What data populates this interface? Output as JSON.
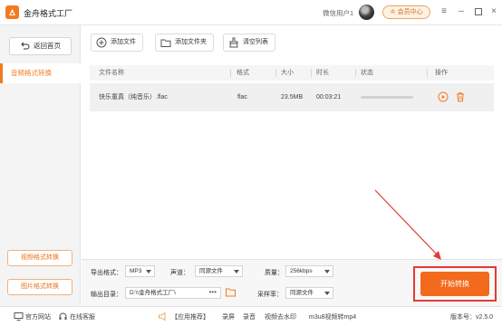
{
  "app": {
    "title": "金舟格式工厂"
  },
  "header": {
    "username": "微信用户1",
    "vip_label": "会员中心"
  },
  "sidebar": {
    "back_label": "返回首页",
    "active_item": "音频格式转换",
    "bottom_buttons": [
      "视频格式转换",
      "图片格式转换"
    ]
  },
  "toolbar": {
    "add_file": "添加文件",
    "add_folder": "添加文件夹",
    "clear_list": "清空列表"
  },
  "table": {
    "headers": [
      "文件名称",
      "格式",
      "大小",
      "时长",
      "状态",
      "操作"
    ],
    "rows": [
      {
        "name": "快乐童真（纯音乐）.flac",
        "format": "flac",
        "size": "23.5MB",
        "duration": "00:03:21",
        "progress": 0
      }
    ]
  },
  "settings": {
    "export_format_label": "导出格式：",
    "export_format_value": "MP3",
    "channel_label": "声道：",
    "channel_value": "同源文件",
    "quality_label": "质量：",
    "quality_value": "256kbps",
    "output_dir_label": "输出目录：",
    "output_dir_value": "D:\\\\金舟格式工厂\\",
    "output_dir_more": "•••",
    "sample_rate_label": "采样率：",
    "sample_rate_value": "同源文件",
    "start_label": "开始转换"
  },
  "statusbar": {
    "website": "官方网站",
    "support": "在线客服",
    "recommend": "【应用推荐】",
    "links": [
      "录屏",
      "录音",
      "视频去水印",
      "m3u8视频转mp4"
    ],
    "version": "版本号：v2.5.0"
  },
  "colors": {
    "accent": "#f27b1f",
    "start_button": "#f26a1b",
    "highlight_frame": "#e53935"
  }
}
